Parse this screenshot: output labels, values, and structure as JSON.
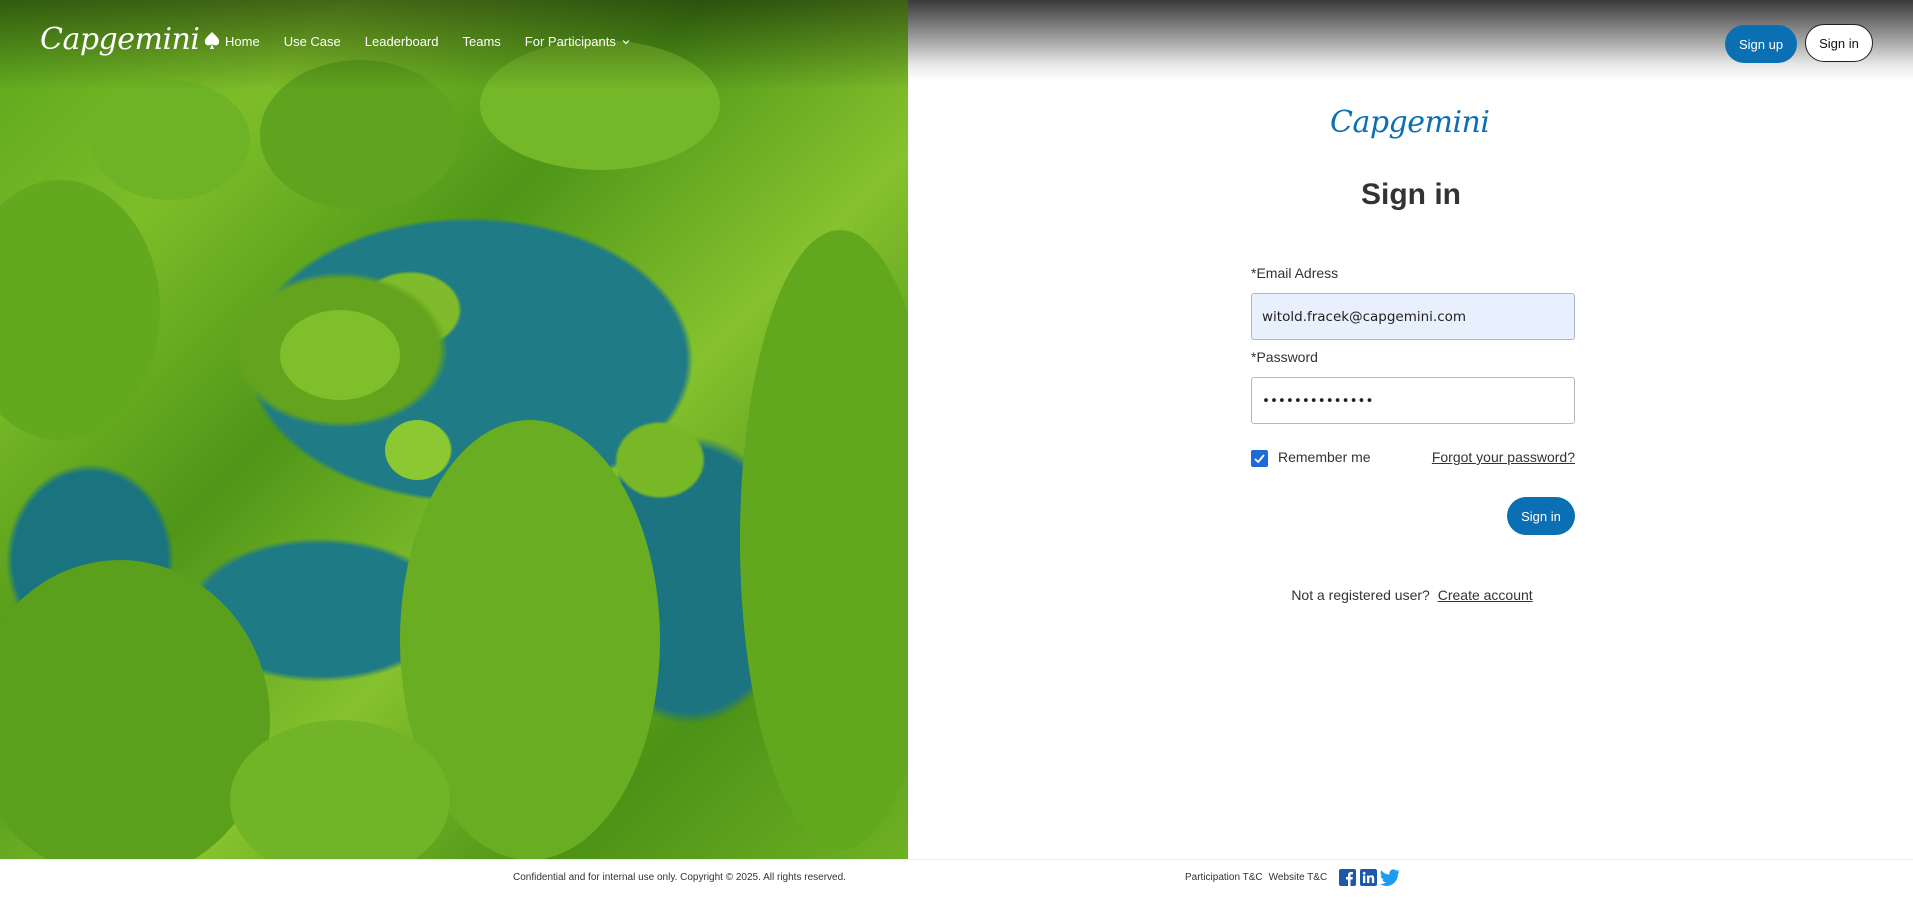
{
  "brand": {
    "name": "Capgemini"
  },
  "nav": {
    "items": [
      {
        "label": "Home"
      },
      {
        "label": "Use Case"
      },
      {
        "label": "Leaderboard"
      },
      {
        "label": "Teams"
      },
      {
        "label": "For Participants"
      }
    ],
    "signup_label": "Sign up",
    "signin_label": "Sign in"
  },
  "form": {
    "title": "Sign in",
    "email_label": "*Email Adress",
    "email_value": "witold.fracek@capgemini.com",
    "password_label": "*Password",
    "password_value": "••••••••••••••",
    "remember_label": "Remember me",
    "remember_checked": true,
    "forgot_label": "Forgot your password?",
    "submit_label": "Sign in",
    "register_prompt": "Not a registered user?",
    "register_link": "Create account"
  },
  "footer": {
    "copyright": "Confidential and for internal use only. Copyright © 2025. All rights reserved.",
    "participation_tc": "Participation T&C",
    "website_tc": "Website T&C",
    "social": [
      "facebook-icon",
      "linkedin-icon",
      "twitter-icon"
    ]
  },
  "colors": {
    "accent": "#0a70b3",
    "checkbox": "#1e6bd6"
  }
}
